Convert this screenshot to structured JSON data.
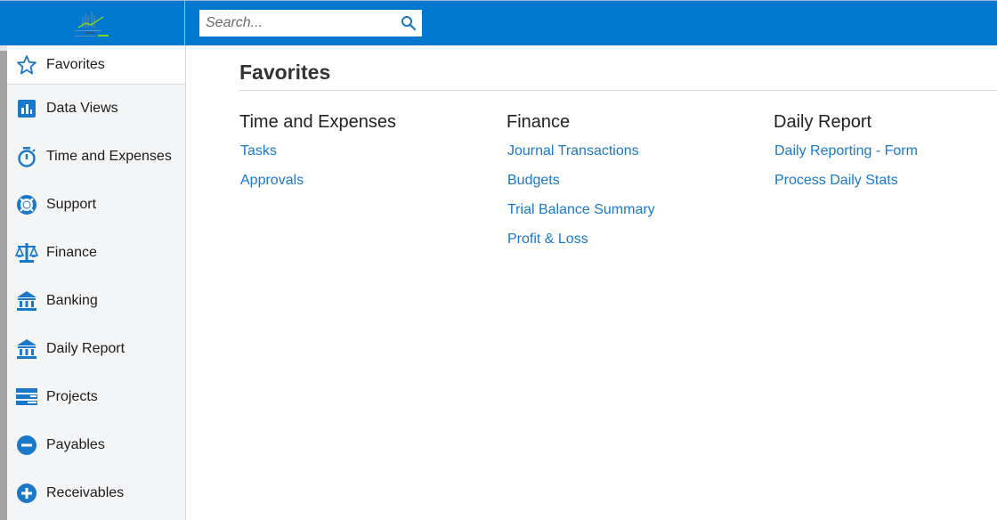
{
  "header": {
    "logo_alt": "Retail Apps logo",
    "search": {
      "placeholder": "Search...",
      "value": "",
      "icon": "search-icon"
    }
  },
  "colors": {
    "brand": "#0078d0",
    "link": "#1a78c8",
    "sidebar_bg": "#f4f5f7",
    "icon": "#1a78c8"
  },
  "sidebar": {
    "items": [
      {
        "label": "Favorites",
        "icon": "star-icon",
        "active": true
      },
      {
        "label": "Data Views",
        "icon": "bar-chart-icon"
      },
      {
        "label": "Time and Expenses",
        "icon": "stopwatch-icon"
      },
      {
        "label": "Support",
        "icon": "lifebuoy-icon"
      },
      {
        "label": "Finance",
        "icon": "scales-icon"
      },
      {
        "label": "Banking",
        "icon": "bank-icon"
      },
      {
        "label": "Daily Report",
        "icon": "bank-icon"
      },
      {
        "label": "Projects",
        "icon": "projects-icon"
      },
      {
        "label": "Payables",
        "icon": "minus-circle-icon"
      },
      {
        "label": "Receivables",
        "icon": "plus-circle-icon"
      }
    ]
  },
  "main": {
    "title": "Favorites",
    "groups": [
      {
        "title": "Time and Expenses",
        "links": [
          "Tasks",
          "Approvals"
        ]
      },
      {
        "title": "Finance",
        "links": [
          "Journal Transactions",
          "Budgets",
          "Trial Balance Summary",
          "Profit & Loss"
        ]
      },
      {
        "title": "Daily Report",
        "links": [
          "Daily Reporting - Form",
          "Process Daily Stats"
        ]
      }
    ]
  }
}
